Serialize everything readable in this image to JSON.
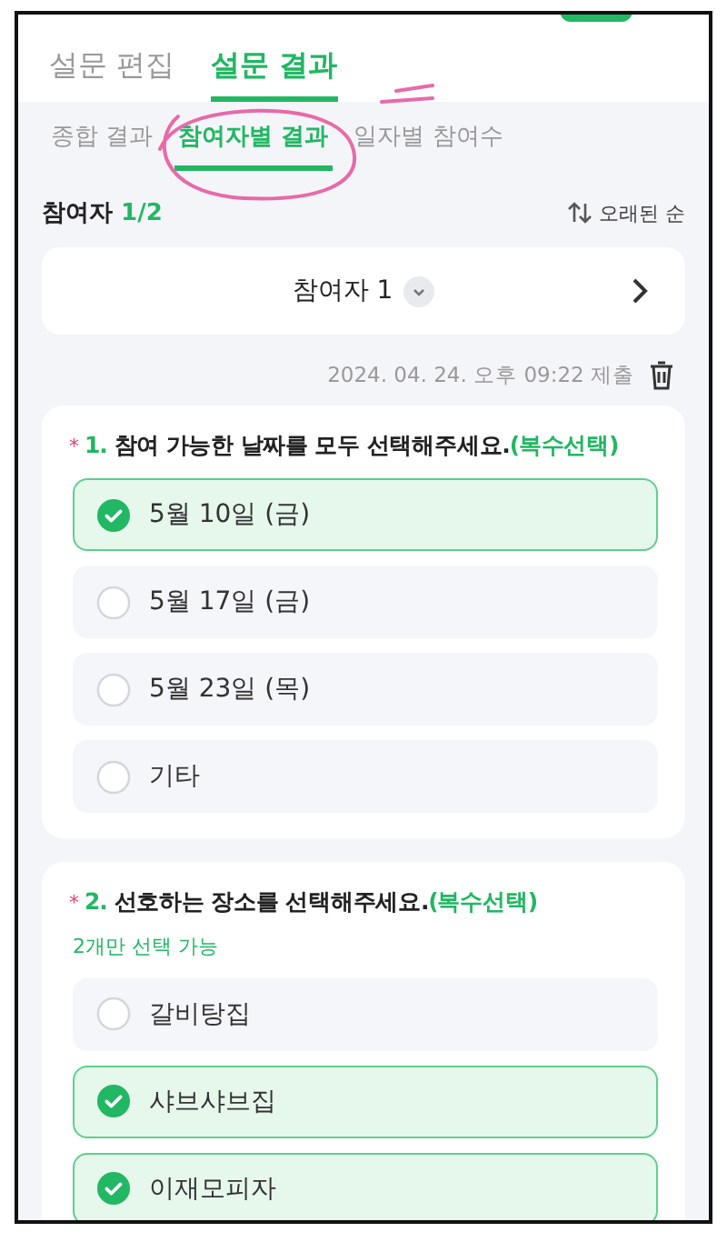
{
  "tabs": [
    {
      "label": "설문 편집",
      "selected": false
    },
    {
      "label": "설문 결과",
      "selected": true
    }
  ],
  "sub_tabs": [
    {
      "label": "종합 결과",
      "selected": false
    },
    {
      "label": "참여자별 결과",
      "selected": true
    },
    {
      "label": "일자별 참여수",
      "selected": false
    }
  ],
  "participant_count": {
    "label": "참여자",
    "value": "1/2"
  },
  "sort": {
    "label": "오래된 순"
  },
  "participant_selector": {
    "label": "참여자 1"
  },
  "submitted": "2024. 04. 24. 오후 09:22 제출",
  "questions": [
    {
      "required": true,
      "marker": "*",
      "number": "1.",
      "title": "참여 가능한 날짜를 모두 선택해주세요.",
      "tag": "(복수선택)",
      "options": [
        {
          "label": "5월 10일 (금)",
          "checked": true
        },
        {
          "label": "5월 17일 (금)",
          "checked": false
        },
        {
          "label": "5월 23일 (목)",
          "checked": false
        },
        {
          "label": "기타",
          "checked": false
        }
      ]
    },
    {
      "required": true,
      "marker": "*",
      "number": "2.",
      "title": "선호하는 장소를 선택해주세요.",
      "tag": "(복수선택)",
      "hint": "2개만 선택 가능",
      "options": [
        {
          "label": "갈비탕집",
          "checked": false
        },
        {
          "label": "샤브샤브집",
          "checked": true
        },
        {
          "label": "이재모피자",
          "checked": true
        }
      ]
    }
  ]
}
